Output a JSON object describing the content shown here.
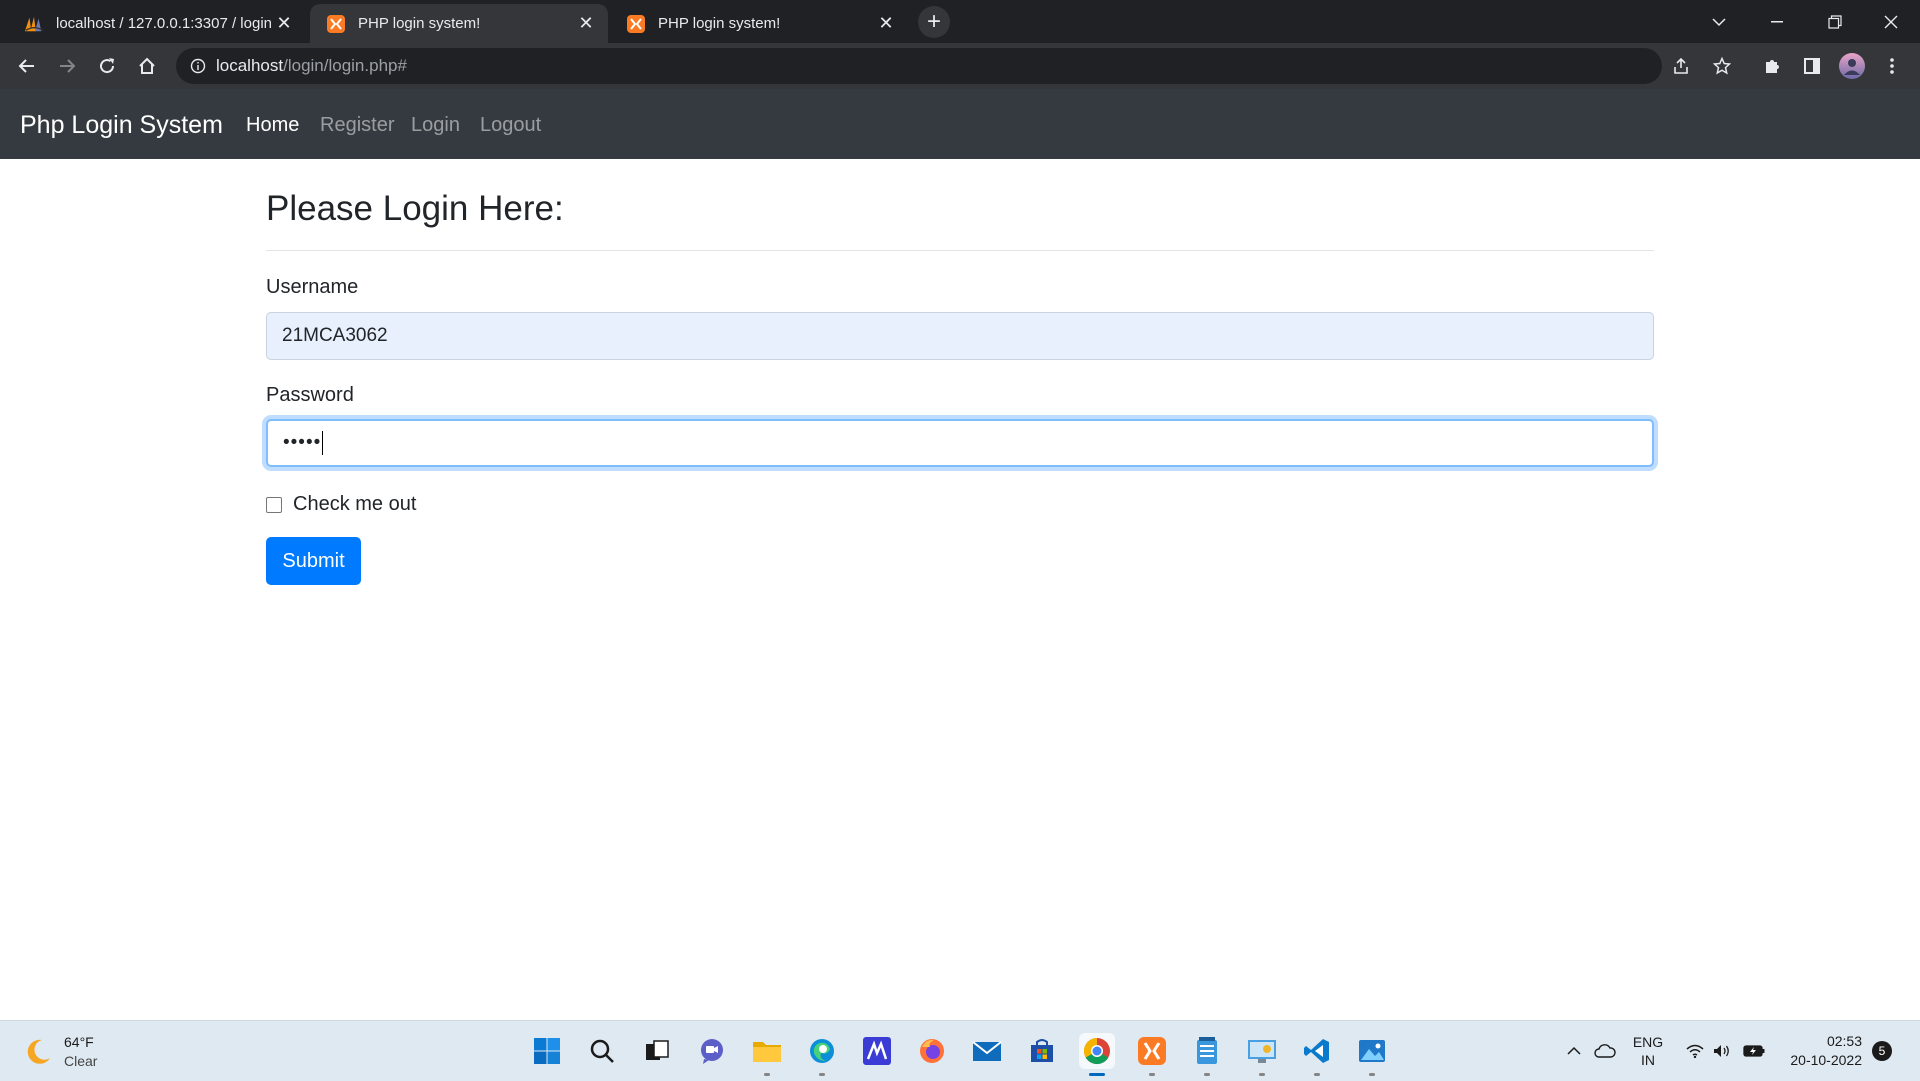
{
  "browser": {
    "tabs": [
      {
        "title": "localhost / 127.0.0.1:3307 / login",
        "icon": "phpmyadmin-icon",
        "active": false
      },
      {
        "title": "PHP login system!",
        "icon": "xampp-icon",
        "active": true
      },
      {
        "title": "PHP login system!",
        "icon": "xampp-icon",
        "active": false
      }
    ],
    "url_host": "localhost",
    "url_path": "/login/login.php#"
  },
  "navbar": {
    "brand": "Php Login System",
    "links": [
      "Home",
      "Register",
      "Login",
      "Logout"
    ],
    "active_link": "Home"
  },
  "form": {
    "heading": "Please Login Here:",
    "username_label": "Username",
    "username_value": "21MCA3062",
    "password_label": "Password",
    "password_value": "•••••",
    "checkbox_label": "Check me out",
    "submit_label": "Submit"
  },
  "taskbar": {
    "weather_temp": "64°F",
    "weather_condition": "Clear",
    "apps": [
      "windows-start",
      "search",
      "task-view",
      "chat",
      "file-explorer",
      "edge",
      "mathworks",
      "firefox",
      "mail",
      "store",
      "chrome",
      "xampp",
      "notepad",
      "control-panel",
      "vscode",
      "photos"
    ],
    "lang_line1": "ENG",
    "lang_line2": "IN",
    "time": "02:53",
    "date": "20-10-2022",
    "notifications": "5"
  },
  "colors": {
    "navbar_bg": "#343a40",
    "primary": "#007bff",
    "autofill_bg": "#e8f0fe",
    "chrome_dark": "#202124"
  }
}
